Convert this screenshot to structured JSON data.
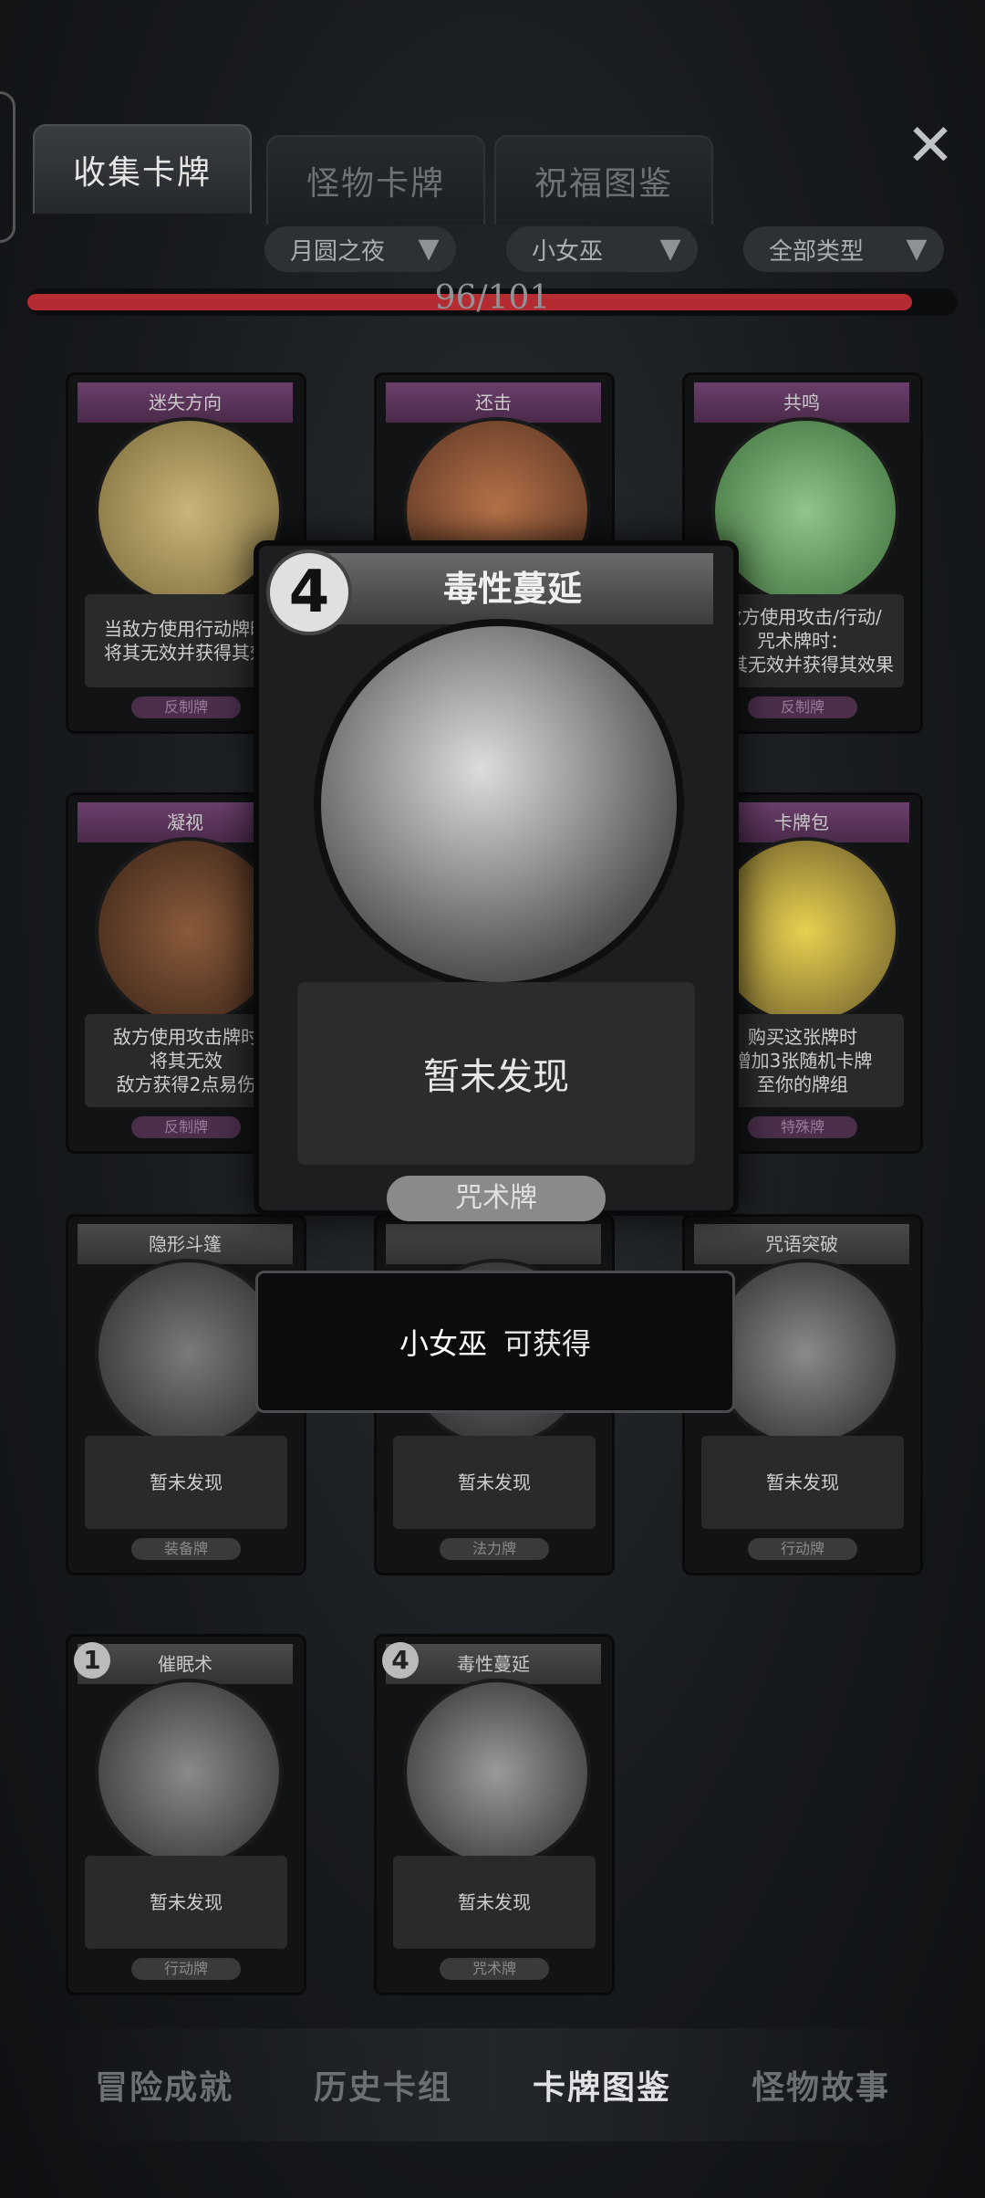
{
  "tabs": [
    {
      "label": "收集卡牌",
      "active": true
    },
    {
      "label": "怪物卡牌",
      "active": false
    },
    {
      "label": "祝福图鉴",
      "active": false
    }
  ],
  "close_icon": "close-icon",
  "filters": [
    {
      "label": "月圆之夜"
    },
    {
      "label": "小女巫"
    },
    {
      "label": "全部类型"
    }
  ],
  "progress": {
    "text": "96/101",
    "collected": 96,
    "total": 101,
    "fill_color": "#b42b32"
  },
  "cards": [
    {
      "title": "迷失方向",
      "desc": "当敌方使用行动牌时\n将其无效并获得其效",
      "type": "反制牌",
      "frame": "purple"
    },
    {
      "title": "还击",
      "desc": "",
      "type": "",
      "frame": "purple"
    },
    {
      "title": "共鸣",
      "desc": "敌方使用攻击/行动/\n咒术牌时：\n将其无效并获得其效果",
      "type": "反制牌",
      "frame": "purple"
    },
    {
      "title": "凝视",
      "desc": "敌方使用攻击牌时\n将其无效\n敌方获得2点易伤",
      "type": "反制牌",
      "frame": "purple"
    },
    {
      "title": "卡牌包",
      "desc": "购买这张牌时\n增加3张随机卡牌\n至你的牌组",
      "type": "特殊牌",
      "frame": "purple"
    },
    {
      "title": "隐形斗篷",
      "desc": "暂未发现",
      "type": "装备牌",
      "frame": "gray"
    },
    {
      "title": "",
      "desc": "暂未发现",
      "type": "法力牌",
      "frame": "gray"
    },
    {
      "title": "咒语突破",
      "desc": "暂未发现",
      "type": "行动牌",
      "frame": "gray"
    },
    {
      "title": "催眠术",
      "desc": "暂未发现",
      "type": "行动牌",
      "frame": "gray",
      "cost": "1"
    },
    {
      "title": "毒性蔓延",
      "desc": "暂未发现",
      "type": "咒术牌",
      "frame": "gray",
      "cost": "4"
    }
  ],
  "popup": {
    "cost": "4",
    "title": "毒性蔓延",
    "desc": "暂未发现",
    "type": "咒术牌",
    "obtain_name": "小女巫",
    "obtain_text": "可获得"
  },
  "nav": [
    {
      "label": "冒险成就",
      "active": false
    },
    {
      "label": "历史卡组",
      "active": false
    },
    {
      "label": "卡牌图鉴",
      "active": true
    },
    {
      "label": "怪物故事",
      "active": false
    }
  ]
}
